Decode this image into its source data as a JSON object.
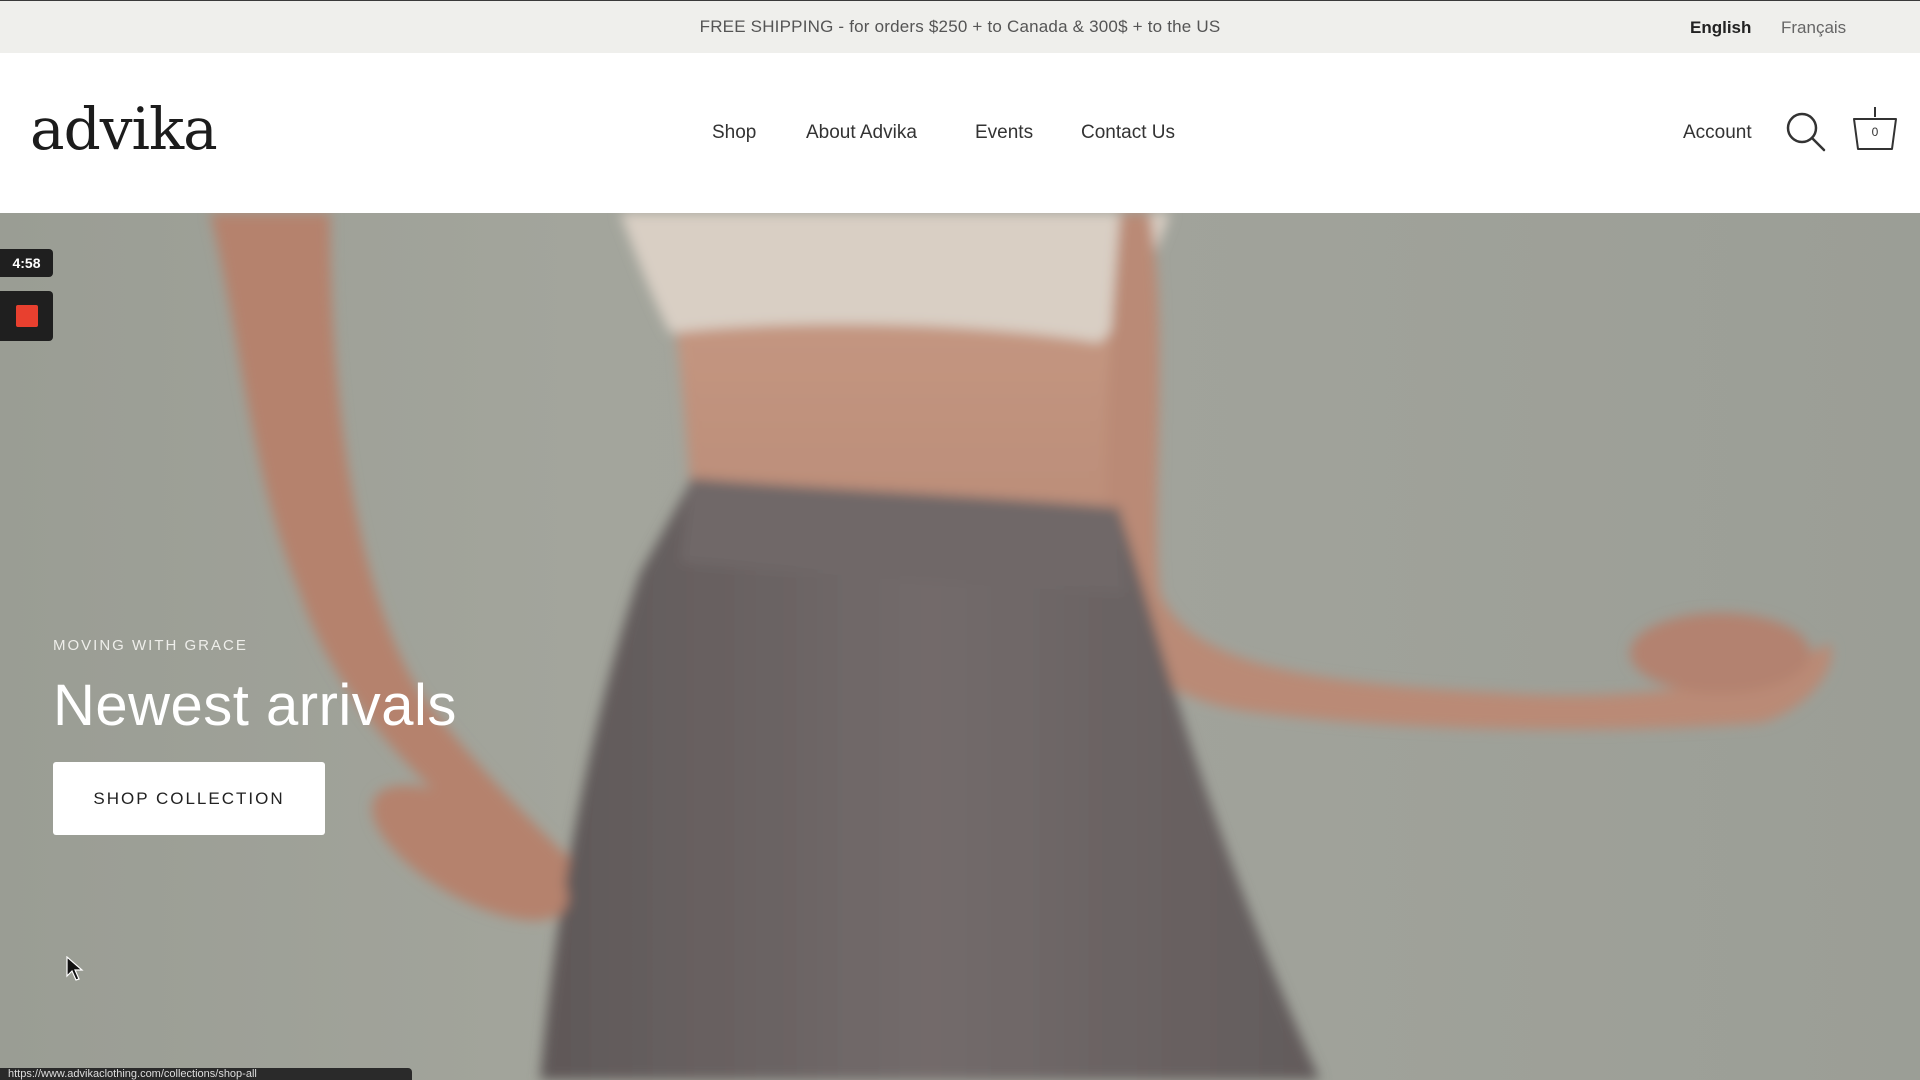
{
  "announcement": {
    "text": "FREE SHIPPING - for orders $250 + to Canada & 300$ + to the US",
    "languages": [
      "English",
      "Français"
    ],
    "active_language": "English"
  },
  "header": {
    "logo": "advika",
    "nav": [
      "Shop",
      "About Advika",
      "Events",
      "Contact Us"
    ],
    "account_label": "Account",
    "search_icon": "search-icon",
    "cart_icon": "cart-basket-icon",
    "cart_count": "0"
  },
  "hero": {
    "eyebrow": "MOVING WITH GRACE",
    "headline": "Newest arrivals",
    "cta_label": "SHOP COLLECTION"
  },
  "recording": {
    "timer": "4:58",
    "stop_icon": "stop-icon",
    "stop_color": "#e8402f"
  },
  "status_bar": {
    "url": "https://www.advikaclothing.com/collections/shop-all"
  }
}
